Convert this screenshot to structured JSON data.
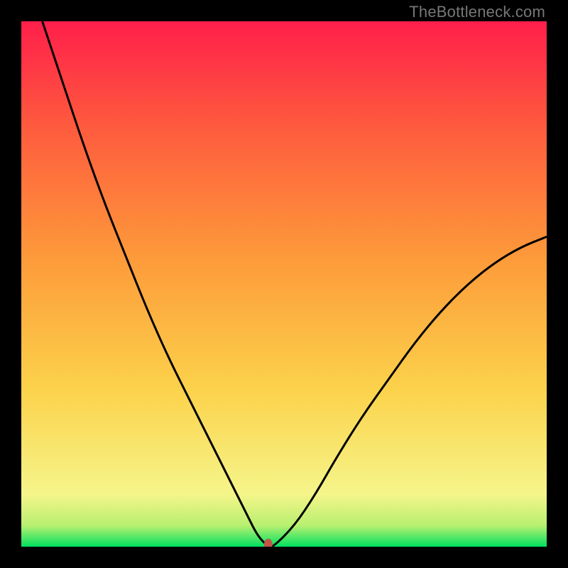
{
  "watermark": "TheBottleneck.com",
  "chart_data": {
    "type": "line",
    "title": "",
    "xlabel": "",
    "ylabel": "",
    "xlim": [
      0,
      100
    ],
    "ylim": [
      0,
      100
    ],
    "background_gradient": {
      "stops": [
        {
          "offset": 0.0,
          "color": "#00e060"
        },
        {
          "offset": 0.04,
          "color": "#b8f070"
        },
        {
          "offset": 0.1,
          "color": "#f5f58a"
        },
        {
          "offset": 0.3,
          "color": "#fcd24a"
        },
        {
          "offset": 0.55,
          "color": "#fd9a3a"
        },
        {
          "offset": 0.8,
          "color": "#fe5a3e"
        },
        {
          "offset": 1.0,
          "color": "#ff1f4a"
        }
      ]
    },
    "series": [
      {
        "name": "bottleneck-curve",
        "type": "line",
        "color": "#000000",
        "x": [
          4,
          8,
          12,
          16,
          20,
          24,
          28,
          32,
          36,
          40,
          43,
          45,
          47,
          48,
          52,
          56,
          60,
          65,
          70,
          75,
          80,
          85,
          90,
          95,
          100
        ],
        "y": [
          100,
          88,
          76,
          65,
          55,
          45,
          36,
          28,
          20,
          12,
          6,
          2,
          0,
          0,
          4,
          10,
          17,
          25,
          32,
          39,
          45,
          50,
          54,
          57,
          59
        ]
      }
    ],
    "marker": {
      "name": "optimal-point",
      "x": 47,
      "y": 0,
      "color": "#c0564a",
      "rx": 6,
      "ry": 8
    }
  }
}
